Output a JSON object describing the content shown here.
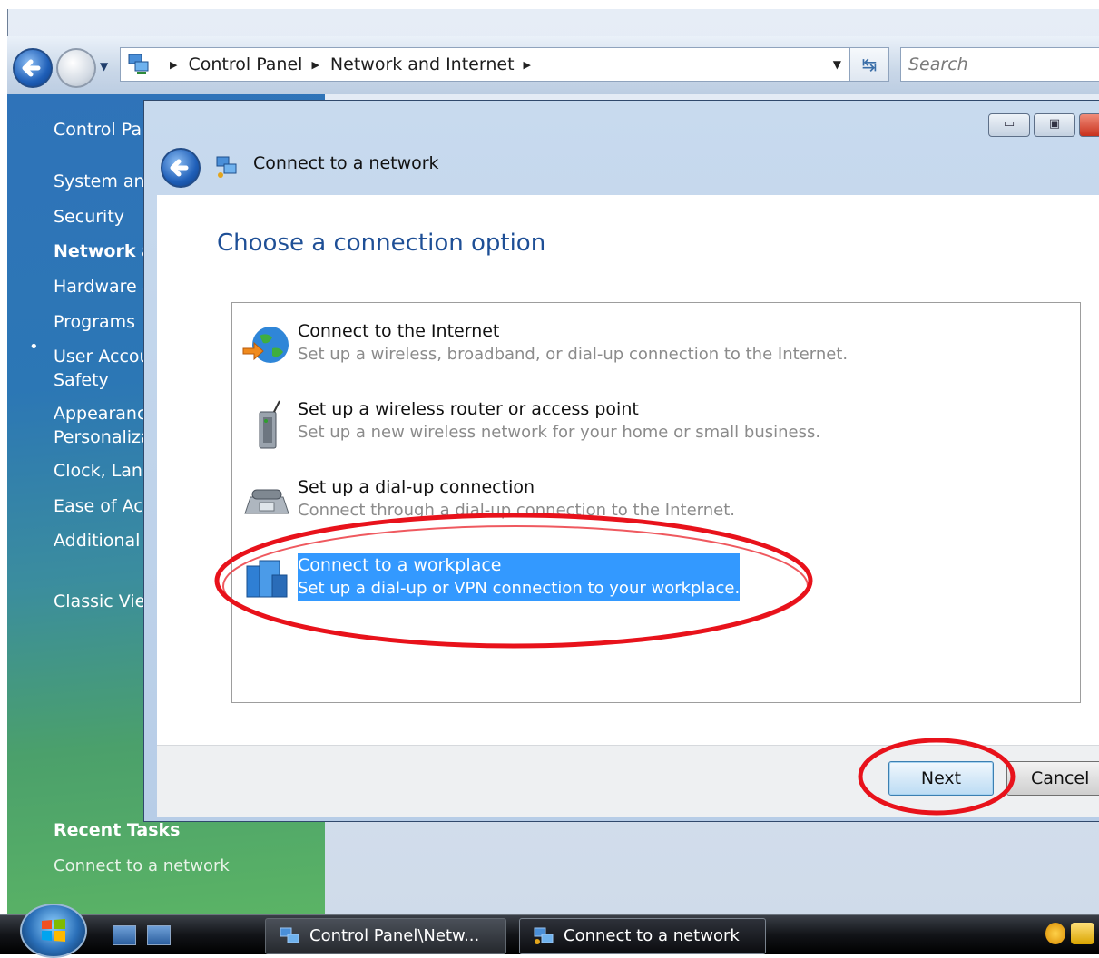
{
  "explorer": {
    "breadcrumb": [
      "Control Panel",
      "Network and Internet"
    ],
    "search_placeholder": "Search"
  },
  "sidebar": {
    "items": [
      {
        "label": "Control Pa",
        "active": false
      },
      {
        "label": "System and",
        "active": false
      },
      {
        "label": "Security",
        "active": false
      },
      {
        "label": "Network a",
        "active": true
      },
      {
        "label": "Hardware a",
        "active": false
      },
      {
        "label": "Programs",
        "active": false
      },
      {
        "label": "User Accou",
        "active": false
      },
      {
        "label": "Safety",
        "active": false
      },
      {
        "label": "Appearanc",
        "active": false
      },
      {
        "label": "Personaliza",
        "active": false
      },
      {
        "label": "Clock, Lan",
        "active": false
      },
      {
        "label": "Ease of Acc",
        "active": false
      },
      {
        "label": "Additional",
        "active": false
      },
      {
        "label": "Classic Vie",
        "active": false
      }
    ],
    "recent_tasks_title": "Recent Tasks",
    "recent_tasks": [
      "Connect to a network"
    ]
  },
  "dialog": {
    "title": "Connect to a network",
    "heading": "Choose a connection option",
    "options": [
      {
        "title": "Connect to the Internet",
        "description": "Set up a wireless, broadband, or dial-up connection to the Internet.",
        "icon": "globe-icon",
        "selected": false
      },
      {
        "title": "Set up a wireless router or access point",
        "description": "Set up a new wireless network for your home or small business.",
        "icon": "wireless-router-icon",
        "selected": false
      },
      {
        "title": "Set up a dial-up connection",
        "description": "Connect through a dial-up connection to the Internet.",
        "icon": "telephone-icon",
        "selected": false
      },
      {
        "title": "Connect to a workplace",
        "description": "Set up a dial-up or VPN connection to your workplace.",
        "icon": "workplace-icon",
        "selected": true
      }
    ],
    "next_label": "Next",
    "cancel_label": "Cancel"
  },
  "taskbar": {
    "buttons": [
      {
        "label": "Control Panel\\Netw...",
        "active": false
      },
      {
        "label": "Connect to a network",
        "active": true
      }
    ]
  },
  "colors": {
    "selection": "#3399ff",
    "heading": "#1e4f96",
    "annotation": "#e8121b"
  }
}
